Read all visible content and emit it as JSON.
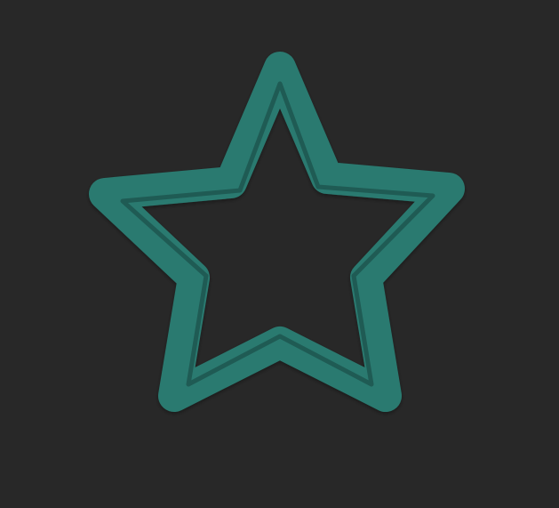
{
  "scene": {
    "background_color": "#282828",
    "star": {
      "icon_name": "star-outline-icon",
      "fill_color": "#2a7a70",
      "shadow_color": "#1f5b54",
      "highlight_color": "#3a9185"
    }
  }
}
